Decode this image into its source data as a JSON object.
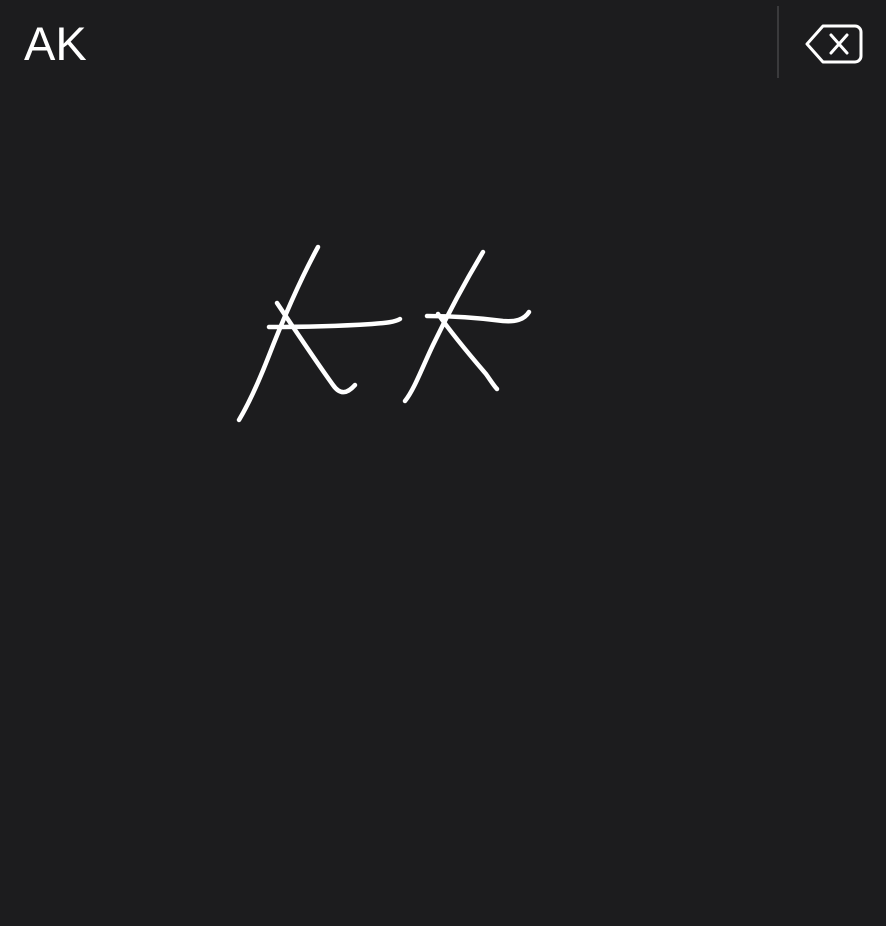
{
  "recognition": {
    "text": "AK"
  },
  "toolbar": {
    "delete_icon": "delete-backward-icon"
  },
  "canvas": {
    "ink_color": "#ffffff",
    "background_color": "#1c1c1e"
  }
}
